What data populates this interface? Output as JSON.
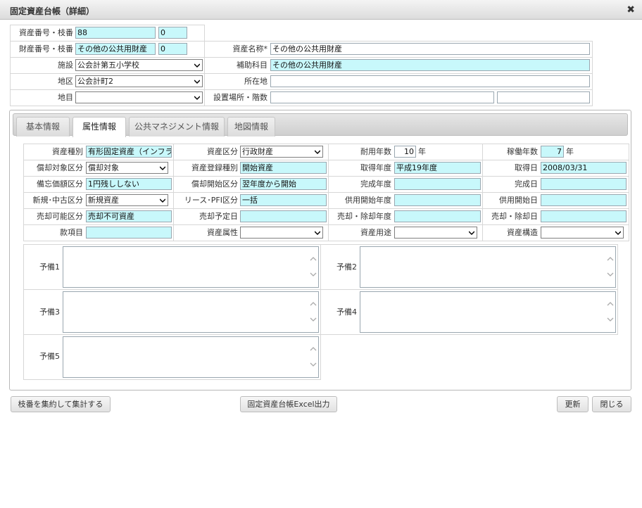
{
  "window": {
    "title": "固定資産台帳（詳細）",
    "close_glyph": "✖"
  },
  "header": {
    "asset_no_label": "資産番号・枝番",
    "asset_no": "88",
    "asset_branch": "0",
    "property_no_label": "財産番号・枝番",
    "property_no": "その他の公共用財産",
    "property_branch": "0",
    "asset_name_label": "資産名称*",
    "asset_name": "その他の公共用財産",
    "facility_label": "施設",
    "facility": "公会計第五小学校",
    "subaccount_label": "補助科目",
    "subaccount": "その他の公共用財産",
    "district_label": "地区",
    "district": "公会計町2",
    "location_label": "所在地",
    "location": "",
    "land_category_label": "地目",
    "land_category": "",
    "install_place_label": "設置場所・階数",
    "install_place": "",
    "floor": ""
  },
  "tabs": [
    {
      "label": "基本情報"
    },
    {
      "label": "属性情報"
    },
    {
      "label": "公共マネジメント情報"
    },
    {
      "label": "地図情報"
    }
  ],
  "attr": {
    "asset_type_label": "資産種別",
    "asset_type": "有形固定資産（インフラ",
    "asset_class_label": "資産区分",
    "asset_class": "行政財産",
    "useful_life_label": "耐用年数",
    "useful_life": "10",
    "useful_life_unit": "年",
    "operating_years_label": "稼働年数",
    "operating_years": "7",
    "operating_years_unit": "年",
    "dep_target_label": "償却対象区分",
    "dep_target": "償却対象",
    "reg_type_label": "資産登録種別",
    "reg_type": "開始資産",
    "acq_year_label": "取得年度",
    "acq_year": "平成19年度",
    "acq_date_label": "取得日",
    "acq_date": "2008/03/31",
    "memo_value_label": "備忘価額区分",
    "memo_value": "1円残ししない",
    "dep_start_label": "償却開始区分",
    "dep_start": "翌年度から開始",
    "complete_year_label": "完成年度",
    "complete_year": "",
    "complete_date_label": "完成日",
    "complete_date": "",
    "new_used_label": "新規･中古区分",
    "new_used": "新規資産",
    "lease_pfi_label": "リース･PFI区分",
    "lease_pfi": "一括",
    "service_start_year_label": "供用開始年度",
    "service_start_year": "",
    "service_start_date_label": "供用開始日",
    "service_start_date": "",
    "saleable_label": "売却可能区分",
    "saleable": "売却不可資産",
    "sale_plan_date_label": "売却予定日",
    "sale_plan_date": "",
    "disposal_year_label": "売却・除却年度",
    "disposal_year": "",
    "disposal_date_label": "売却・除却日",
    "disposal_date": "",
    "item_label": "款項目",
    "item": "",
    "asset_attr_label": "資産属性",
    "asset_attr": "",
    "asset_use_label": "資産用途",
    "asset_use": "",
    "asset_structure_label": "資産構造",
    "asset_structure": ""
  },
  "spare": [
    {
      "label": "予備1",
      "value": ""
    },
    {
      "label": "予備2",
      "value": ""
    },
    {
      "label": "予備3",
      "value": ""
    },
    {
      "label": "予備4",
      "value": ""
    },
    {
      "label": "予備5",
      "value": ""
    }
  ],
  "footer": {
    "aggregate_label": "枝番を集約して集計する",
    "excel_label": "固定資産台帳Excel出力",
    "update_label": "更新",
    "close_label": "閉じる"
  },
  "colors": {
    "input_cyan": "#c8f8fb",
    "border": "#9aa7b0"
  }
}
